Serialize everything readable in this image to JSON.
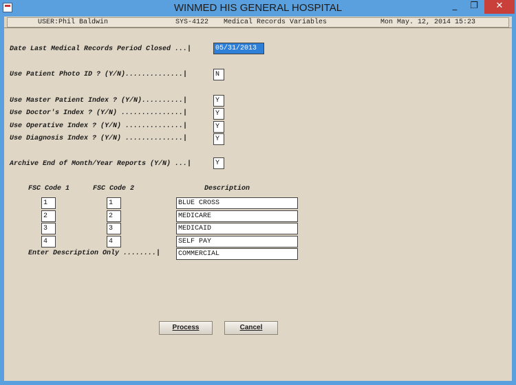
{
  "window": {
    "title": "WINMED HIS GENERAL HOSPITAL"
  },
  "controls": {
    "minimize": "_",
    "maximize": "❐",
    "close": "✕"
  },
  "status": {
    "user": "USER:Phil Baldwin",
    "screen": "SYS-4122",
    "screen_title": "Medical Records Variables",
    "datetime": "Mon May. 12, 2014 15:23"
  },
  "form": {
    "period_closed_label": "Date Last Medical Records Period Closed ...|",
    "period_closed_value": "05/31/2013",
    "photo_id_label": "Use Patient Photo ID ? (Y/N)..............|",
    "photo_id_value": "N",
    "mpi_label": "Use Master Patient Index ? (Y/N)..........|",
    "mpi_value": "Y",
    "doctor_label": "Use Doctor's Index ? (Y/N) ...............|",
    "doctor_value": "Y",
    "operative_label": "Use Operative Index ? (Y/N) ..............|",
    "operative_value": "Y",
    "diagnosis_label": "Use Diagnosis Index ? (Y/N) ..............|",
    "diagnosis_value": "Y",
    "archive_label": "Archive End of Month/Year Reports (Y/N) ...|",
    "archive_value": "Y"
  },
  "fsc": {
    "col1": "FSC Code 1",
    "col2": "FSC Code 2",
    "col3": "Description",
    "rows": [
      {
        "code1": "1",
        "code2": "1",
        "desc": "BLUE CROSS"
      },
      {
        "code1": "2",
        "code2": "2",
        "desc": "MEDICARE"
      },
      {
        "code1": "3",
        "code2": "3",
        "desc": "MEDICAID"
      },
      {
        "code1": "4",
        "code2": "4",
        "desc": "SELF PAY"
      }
    ],
    "desc_only_label": "Enter Description Only ........|",
    "desc_only_value": "COMMERCIAL"
  },
  "buttons": {
    "process": "Process",
    "cancel": "Cancel"
  }
}
